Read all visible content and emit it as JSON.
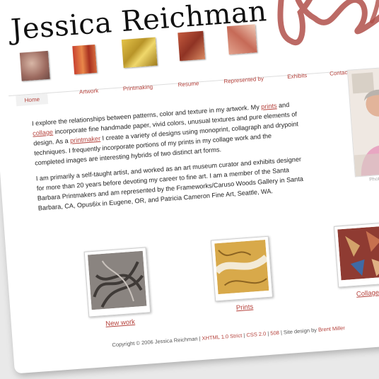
{
  "header": {
    "site_title": "Jessica Reichman"
  },
  "nav": {
    "items": [
      {
        "label": "Home"
      },
      {
        "label": "Artwork"
      },
      {
        "label": "Printmaking"
      },
      {
        "label": "Resume"
      },
      {
        "label": "Represented by"
      },
      {
        "label": "Exhibits"
      },
      {
        "label": "Contact the artist"
      }
    ]
  },
  "intro": {
    "p1_a": "I explore the relationships between patterns, color and texture in my artwork. My ",
    "link_prints": "prints",
    "p1_b": " and ",
    "link_collage": "collage",
    "p1_c": " incorporate fine handmade paper, vivid colors, unusual textures and pure elements of design. As a ",
    "link_printmaker": "printmaker",
    "p1_d": " I create a variety of designs using monoprint, collagraph and drypoint techniques. I frequently incorporate portions of my prints in my collage work and the completed images are interesting hybrids of two distinct art forms.",
    "p2": "I am primarily a self-taught artist, and worked as an art museum curator and exhibits designer for more than 20 years before devoting my career to fine art. I am a member of the Santa Barbara Printmakers and am represented by the Frameworks/Caruso Woods Gallery in Santa Barbara, CA, Opus6ix in Eugene, OR, and Patricia Cameron Fine Art, Seattle, WA."
  },
  "photo": {
    "caption": "Photo b"
  },
  "gallery": {
    "items": [
      {
        "label": "New work"
      },
      {
        "label": "Prints"
      },
      {
        "label": "Collage"
      }
    ]
  },
  "footer": {
    "copyright": "Copyright © 2006 Jessica Reichman | ",
    "xhtml": "XHTML 1.0 Strict",
    "sep1": " | ",
    "css": "CSS 2.0",
    "sep2": " | ",
    "num": "508",
    "design_prefix": " | Site design by ",
    "designer": "Brent Miller"
  },
  "colors": {
    "accent": "#b5423c",
    "signature": "#b0504a"
  }
}
